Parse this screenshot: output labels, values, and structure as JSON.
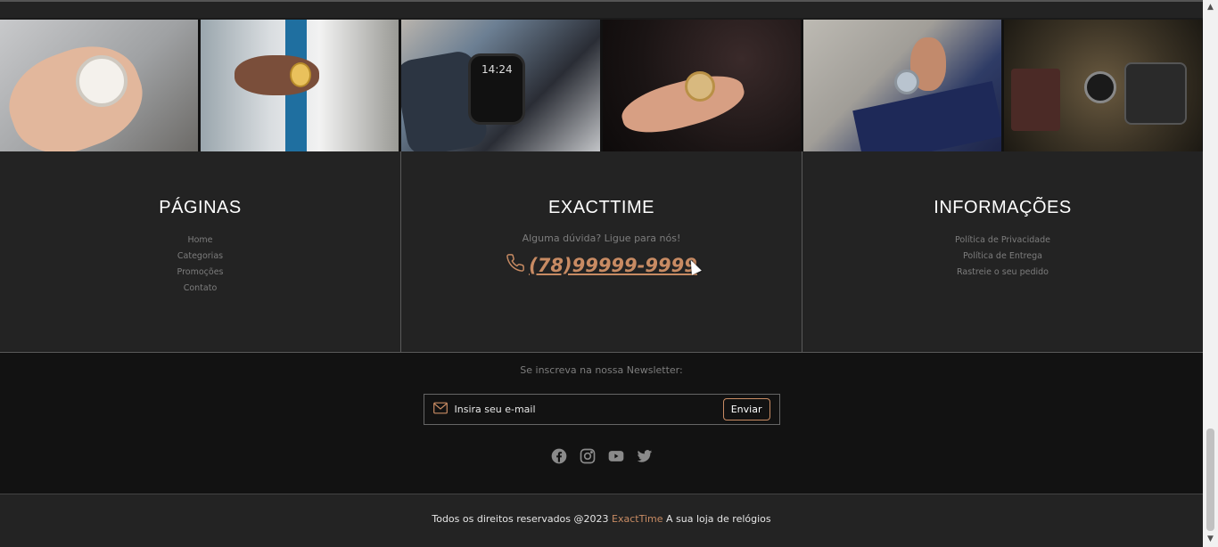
{
  "gallery": {
    "photos": [
      "photo-1",
      "photo-2",
      "photo-3",
      "photo-4",
      "photo-5",
      "photo-6"
    ],
    "smartwatch_time": "14:24"
  },
  "pages_col": {
    "title": "PÁGINAS",
    "links": [
      "Home",
      "Categorias",
      "Promoções",
      "Contato"
    ]
  },
  "exacttime_col": {
    "title": "EXACTTIME",
    "question": "Alguma dúvida? Ligue para nós!",
    "phone": "(78)99999-9999",
    "phone_icon": "phone-icon"
  },
  "info_col": {
    "title": "INFORMAÇÕES",
    "links": [
      "Política de Privacidade",
      "Política de Entrega",
      "Rastreie o seu pedido"
    ]
  },
  "newsletter": {
    "label": "Se inscreva na nossa Newsletter:",
    "placeholder": "Insira seu e-mail",
    "button": "Enviar",
    "icon": "mail-icon"
  },
  "socials": [
    "facebook-icon",
    "instagram-icon",
    "youtube-icon",
    "twitter-icon"
  ],
  "copyright": {
    "prefix": "Todos os direitos reservados @2023",
    "brand": "ExactTime",
    "suffix": "A sua loja de relógios"
  },
  "colors": {
    "accent": "#c88b63",
    "background": "#232323",
    "newsletter_bg": "#121212",
    "muted_text": "#7d7d7d"
  }
}
